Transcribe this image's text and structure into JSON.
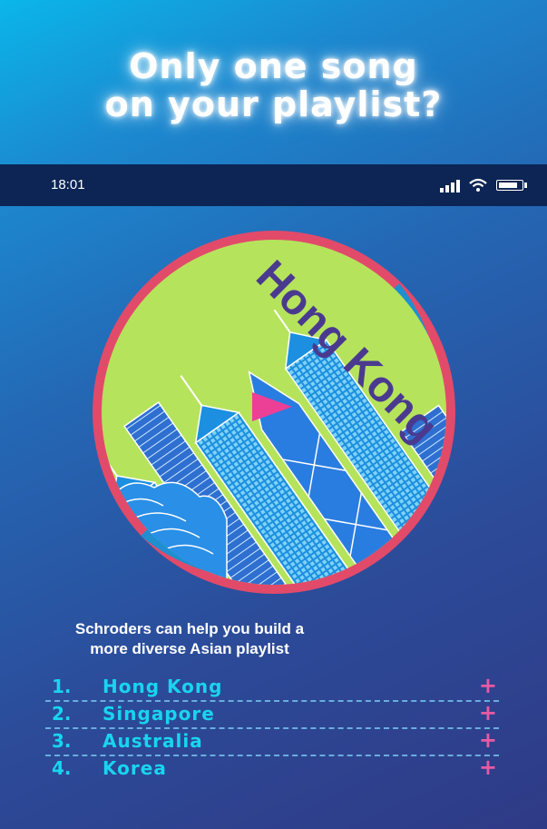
{
  "headline": {
    "line1": "Only one song",
    "line2": "on your playlist?"
  },
  "status_bar": {
    "time": "18:01",
    "icons": [
      "signal-icon",
      "wifi-icon",
      "battery-icon"
    ]
  },
  "album": {
    "title": "Hong Kong",
    "icon": "play-icon"
  },
  "caption": {
    "line1": "Schroders can help you build a",
    "line2": "more diverse Asian playlist"
  },
  "playlist": [
    {
      "number": "1.",
      "name": "Hong Kong",
      "action": "+"
    },
    {
      "number": "2.",
      "name": "Singapore",
      "action": "+"
    },
    {
      "number": "3.",
      "name": "Australia",
      "action": "+"
    },
    {
      "number": "4.",
      "name": "Korea",
      "action": "+"
    }
  ],
  "colors": {
    "background_top": "#0ab6ea",
    "background_bottom": "#2f3a86",
    "status_bar": "#0c2554",
    "disc_fill": "#b6e35c",
    "disc_ring_pink": "#e24a6a",
    "disc_ring_blue": "#1f8fd0",
    "album_title": "#4a3a8f",
    "play_triangle": "#ec3f96",
    "track_text": "#19d4f0",
    "add_icon": "#e85aa4"
  }
}
